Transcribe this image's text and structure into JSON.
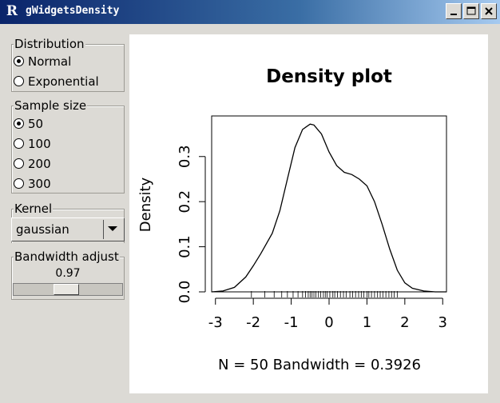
{
  "window": {
    "title": "gWidgetsDensity",
    "app_icon": "R"
  },
  "distribution": {
    "label": "Distribution",
    "options": [
      "Normal",
      "Exponential"
    ],
    "selected": "Normal"
  },
  "sample_size": {
    "label": "Sample size",
    "options": [
      "50",
      "100",
      "200",
      "300"
    ],
    "selected": "50"
  },
  "kernel": {
    "label": "Kernel",
    "value": "gaussian"
  },
  "bandwidth": {
    "label": "Bandwidth adjust",
    "value": "0.97",
    "slider_position": 0.48
  },
  "chart_data": {
    "type": "line",
    "title": "Density plot",
    "ylabel": "Density",
    "xlabel": "N = 50   Bandwidth = 0.3926",
    "xlim": [
      -3.1,
      3.1
    ],
    "ylim": [
      0,
      0.39
    ],
    "x_ticks": [
      "-3",
      "-2",
      "-1",
      "0",
      "1",
      "2",
      "3"
    ],
    "y_ticks": [
      "0.0",
      "0.1",
      "0.2",
      "0.3"
    ],
    "series": [
      {
        "x": [
          -3.1,
          -2.8,
          -2.5,
          -2.2,
          -2.0,
          -1.8,
          -1.5,
          -1.3,
          -1.1,
          -0.9,
          -0.7,
          -0.5,
          -0.4,
          -0.2,
          0.0,
          0.2,
          0.4,
          0.6,
          0.8,
          1.0,
          1.2,
          1.4,
          1.6,
          1.8,
          2.0,
          2.2,
          2.5,
          2.8,
          3.1
        ],
        "y": [
          0.0,
          0.002,
          0.01,
          0.033,
          0.058,
          0.085,
          0.13,
          0.18,
          0.25,
          0.32,
          0.36,
          0.372,
          0.37,
          0.35,
          0.31,
          0.28,
          0.265,
          0.26,
          0.25,
          0.235,
          0.2,
          0.15,
          0.095,
          0.048,
          0.02,
          0.008,
          0.002,
          0.0,
          0.0
        ]
      }
    ],
    "rug": [
      -2.05,
      -1.7,
      -1.45,
      -1.25,
      -1.1,
      -0.95,
      -0.82,
      -0.7,
      -0.62,
      -0.55,
      -0.5,
      -0.45,
      -0.4,
      -0.35,
      -0.28,
      -0.22,
      -0.15,
      -0.1,
      -0.05,
      0.02,
      0.1,
      0.15,
      0.22,
      0.3,
      0.38,
      0.45,
      0.55,
      0.62,
      0.7,
      0.78,
      0.85,
      0.92,
      1.0,
      1.05,
      1.12,
      1.2,
      1.28,
      1.35,
      1.42,
      1.5,
      1.58,
      1.65,
      1.72,
      1.8
    ]
  }
}
